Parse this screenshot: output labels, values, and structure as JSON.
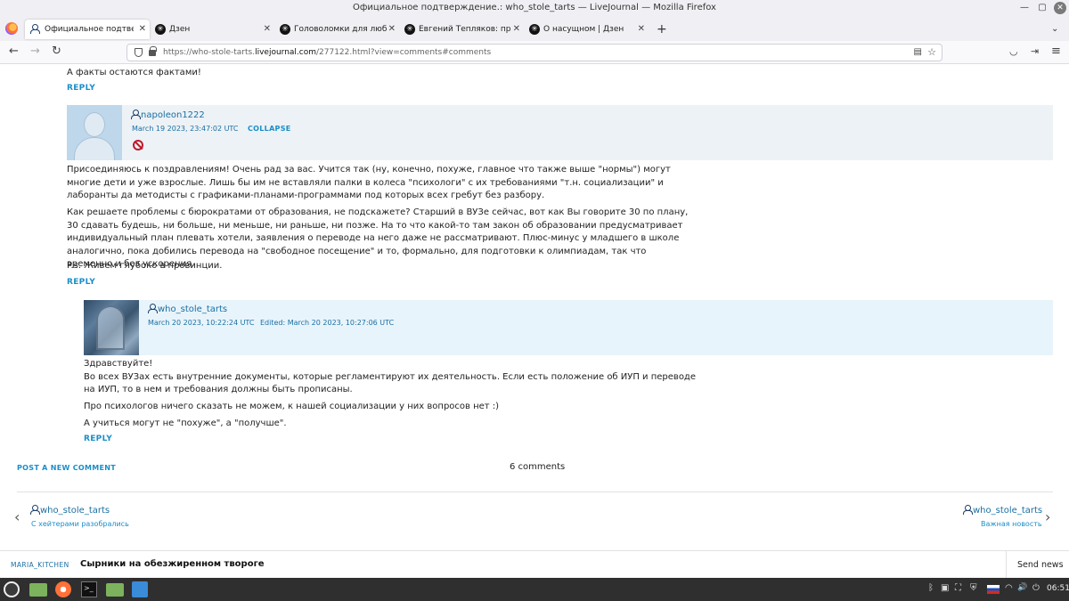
{
  "window": {
    "title": "Официальное подтверждение.: who_stole_tarts — LiveJournal — Mozilla Firefox",
    "minimize": "—",
    "maximize": "▢",
    "close": "✕"
  },
  "tabs": [
    {
      "label": "Официальное подтвержде",
      "icon": "livejournal-user-icon",
      "close": "✕",
      "active": true
    },
    {
      "label": "Дзен",
      "icon": "zen-icon",
      "close": "✕",
      "active": false
    },
    {
      "label": "Головоломки для любозна",
      "icon": "zen-icon",
      "close": "✕",
      "active": false
    },
    {
      "label": "Евгений Тепляков: претен",
      "icon": "zen-icon",
      "close": "✕",
      "active": false
    },
    {
      "label": "О насущном | Дзен",
      "icon": "zen-icon",
      "close": "✕",
      "active": false
    }
  ],
  "tabstrip": {
    "new_tab": "+",
    "list_all": "⌄"
  },
  "navbar": {
    "back": "←",
    "forward": "→",
    "reload": "↻",
    "url_prefix": "https://who-stole-tarts.",
    "url_domain": "livejournal.com",
    "url_path": "/277122.html?view=comments#comments",
    "reader_icon": "▤",
    "star_icon": "☆",
    "pocket_icon": "◡",
    "extensions_icon": "⇥",
    "menu_icon": "≡"
  },
  "page": {
    "prev_comment_text": "А факты остаются фактами!",
    "reply_label": "REPLY",
    "comments": [
      {
        "username": "napoleon1222",
        "date": "March 19 2023, 23:47:02 UTC",
        "action": "COLLAPSE",
        "paragraphs": [
          "Присоединяюсь к поздравлениям! Очень рад за вас. Учится так (ну, конечно, похуже, главное что также выше \"нормы\") могут многие дети и уже взрослые. Лишь бы им не вставляли палки в колеса \"психологи\" с их требованиями \"т.н. социализации\" и лаборанты да методисты с графиками-планами-программами под которых всех гребут без разбору.",
          "Как решаете проблемы с бюрократами от образования, не подскажете? Старший в ВУЗе сейчас, вот как Вы говорите 30 по плану, 30 сдавать будешь, ни больше, ни меньше, ни раньше, ни позже. На то что какой-то там закон об образовании предусматривает индивидуальный план плевать хотели, заявления о переводе на него даже не рассматривают. Плюс-минус у младшего в школе аналогично, пока добились перевода на \"свободное посещение\" и то, формально, для подготовки к олимпиадам, так что временно и без ускорения.",
          "P.s. Живем глубоко в провинции."
        ],
        "reply": "REPLY"
      },
      {
        "username": "who_stole_tarts",
        "date": "March 20 2023, 10:22:24 UTC",
        "edited": "Edited:  March 20 2023, 10:27:06 UTC",
        "paragraphs": [
          "Здравствуйте!\nВо всех ВУЗах есть внутренние документы, которые регламентируют их деятельность. Если есть положение об ИУП и переводе на ИУП, то в нем и требования должны быть прописаны.",
          "Про психологов ничего сказать не можем, к нашей социализации у них вопросов нет :)",
          "А учиться могут не \"похуже\", а \"получше\"."
        ],
        "reply": "REPLY"
      }
    ],
    "post_new_comment": "POST A NEW COMMENT",
    "comments_count": "6 comments",
    "prev_post": {
      "user": "who_stole_tarts",
      "title": "С хейтерами разобрались",
      "arrow": "‹"
    },
    "next_post": {
      "user": "who_stole_tarts",
      "title": "Важная новость",
      "arrow": "›"
    }
  },
  "promo": {
    "source": "MARIA_KITCHEN",
    "title": "Сырники на обезжиренном твороге",
    "send": "Send news"
  },
  "taskbar": {
    "terminal_glyph": ">_",
    "tray": {
      "bluetooth": "ᛒ",
      "clipboard": "▣",
      "network_mgr": "⛶",
      "shield": "⛨",
      "volume": "🔊",
      "wifi": "◠",
      "power": "⏻"
    },
    "clock": "06:51"
  },
  "colors": {
    "link": "#1a6fa3",
    "accent": "#1a8ec9",
    "header_bg": "#edf2f6",
    "reply_header_bg": "#e8f4fb"
  }
}
